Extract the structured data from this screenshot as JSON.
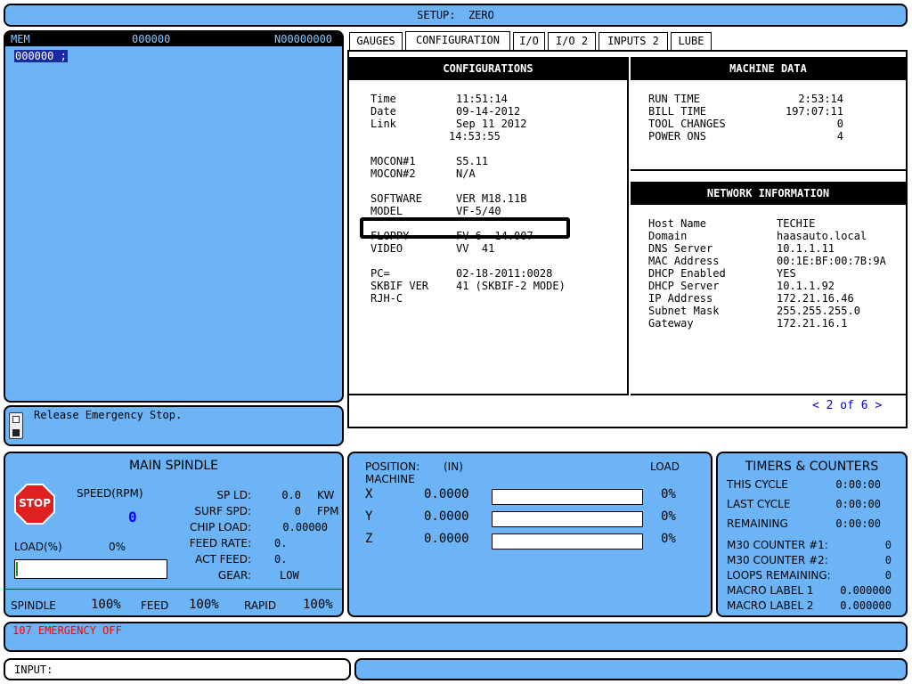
{
  "title": "SETUP:  ZERO",
  "program": {
    "mode": "MEM",
    "prog_num": "000000",
    "seq_num": "N00000000",
    "line": "000000 ;"
  },
  "message": "Release Emergency Stop.",
  "tabs": [
    "GAUGES",
    "CONFIGURATION",
    "I/O",
    "I/O 2",
    "INPUTS 2",
    "LUBE"
  ],
  "active_tab": "CONFIGURATION",
  "configurations": {
    "header": "CONFIGURATIONS",
    "rows": [
      {
        "k": "Time",
        "v": "11:51:14"
      },
      {
        "k": "Date",
        "v": "09-14-2012"
      },
      {
        "k": "Link",
        "v": "Sep 11 2012"
      },
      {
        "k": "",
        "v": "14:53:55"
      },
      {
        "k": "MOCON#1",
        "v": "S5.11"
      },
      {
        "k": "MOCON#2",
        "v": "N/A"
      },
      {
        "k": "SOFTWARE",
        "v": "VER M18.11B"
      },
      {
        "k": "MODEL",
        "v": "VF-5/40"
      },
      {
        "k": "FLOPPY",
        "v": "FV 6  14.007"
      },
      {
        "k": "VIDEO",
        "v": "VV  41"
      },
      {
        "k": "PC=",
        "v": "02-18-2011:0028"
      },
      {
        "k": "SKBIF VER",
        "v": "41 (SKBIF-2 MODE)"
      },
      {
        "k": "RJH-C",
        "v": ""
      }
    ]
  },
  "machine_data": {
    "header": "MACHINE DATA",
    "rows": [
      {
        "k": "RUN TIME",
        "v": "2:53:14"
      },
      {
        "k": "BILL TIME",
        "v": "197:07:11"
      },
      {
        "k": "TOOL CHANGES",
        "v": "0"
      },
      {
        "k": "POWER ONS",
        "v": "4"
      }
    ]
  },
  "network": {
    "header": "NETWORK INFORMATION",
    "rows": [
      {
        "k": "Host Name",
        "v": "TECHIE"
      },
      {
        "k": "Domain",
        "v": "haasauto.local"
      },
      {
        "k": "DNS Server",
        "v": "10.1.1.11"
      },
      {
        "k": "MAC Address",
        "v": "00:1E:BF:00:7B:9A"
      },
      {
        "k": "DHCP Enabled",
        "v": "YES"
      },
      {
        "k": "DHCP Server",
        "v": "10.1.1.92"
      },
      {
        "k": "IP Address",
        "v": "172.21.16.46"
      },
      {
        "k": "Subnet Mask",
        "v": "255.255.255.0"
      },
      {
        "k": "Gateway",
        "v": "172.21.16.1"
      }
    ]
  },
  "pager": "< 2 of 6 >",
  "spindle": {
    "title": "MAIN SPINDLE",
    "stop_label": "STOP",
    "speed_label": "SPEED(RPM)",
    "speed_value": "0",
    "load_label": "LOAD(%)",
    "load_value": "0%",
    "load_fraction": 0,
    "params": [
      {
        "k": "SP LD:",
        "v": "0.0",
        "u": "KW"
      },
      {
        "k": "SURF SPD:",
        "v": "0",
        "u": "FPM"
      },
      {
        "k": "CHIP LOAD:",
        "v": "0.00000",
        "u": ""
      },
      {
        "k": "FEED RATE:",
        "v": "0.",
        "u": ""
      },
      {
        "k": "ACT FEED:",
        "v": "0.",
        "u": ""
      },
      {
        "k": "GEAR:",
        "v": "LOW",
        "u": ""
      }
    ],
    "overrides": [
      {
        "k": "SPINDLE",
        "v": "100%"
      },
      {
        "k": "FEED",
        "v": "100%"
      },
      {
        "k": "RAPID",
        "v": "100%"
      }
    ]
  },
  "position": {
    "title": "POSITION:",
    "unit": "(IN)",
    "subtitle": "MACHINE",
    "load_label": "LOAD",
    "axes": [
      {
        "axis": "X",
        "value": "0.0000",
        "load": "0%",
        "load_fraction": 0
      },
      {
        "axis": "Y",
        "value": "0.0000",
        "load": "0%",
        "load_fraction": 0
      },
      {
        "axis": "Z",
        "value": "0.0000",
        "load": "0%",
        "load_fraction": 0
      }
    ]
  },
  "timers": {
    "title": "TIMERS & COUNTERS",
    "rows": [
      {
        "k": "THIS CYCLE",
        "v": "0:00:00"
      },
      {
        "k": "LAST CYCLE",
        "v": "0:00:00"
      },
      {
        "k": "REMAINING",
        "v": "0:00:00"
      }
    ],
    "counters": [
      {
        "k": "M30 COUNTER #1:",
        "v": "0"
      },
      {
        "k": "M30 COUNTER #2:",
        "v": "0"
      },
      {
        "k": "LOOPS REMAINING:",
        "v": "0"
      },
      {
        "k": "MACRO LABEL 1",
        "v": "0.000000"
      },
      {
        "k": "MACRO LABEL 2",
        "v": "0.000000"
      }
    ]
  },
  "alarm": "107 EMERGENCY OFF",
  "input_label": "INPUT:",
  "colors": {
    "panel": "#6cb4f5",
    "alarm": "#ff0000",
    "speed": "#0000ff",
    "pager": "#0000cc",
    "stop": "#e02020"
  }
}
